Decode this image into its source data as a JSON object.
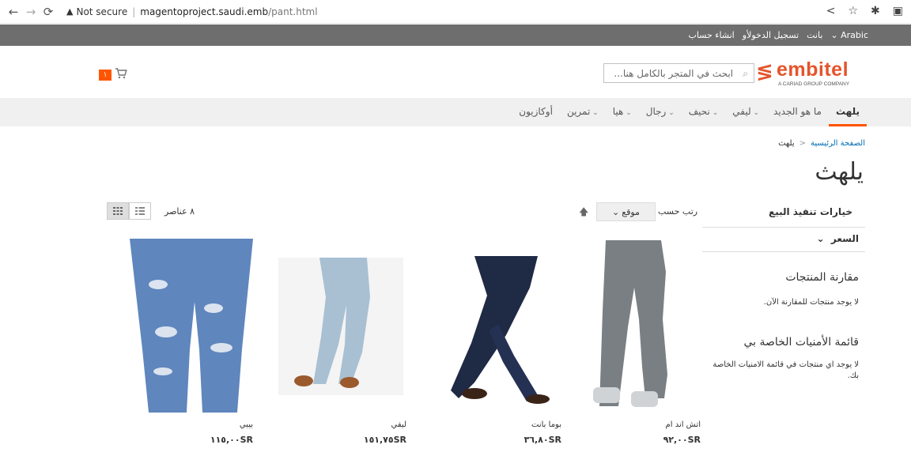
{
  "browser": {
    "security_text": "Not secure",
    "url_host": "magentoproject.saudi.emb",
    "url_path": "/pant.html"
  },
  "topbar": {
    "language": "Arabic",
    "link_pants": "بانت",
    "link_signin": "تسجيل الدخول",
    "link_or": "أو",
    "link_create": "انشاء حساب"
  },
  "header": {
    "logo_word": "embitel",
    "logo_tag": "A CARIAD GROUP COMPANY",
    "search_placeholder": "ابحث في المتجر بالكامل هنا...",
    "cart_count": "١"
  },
  "nav": {
    "items": [
      {
        "label": "يلهث",
        "dropdown": false,
        "active": true
      },
      {
        "label": "ما هو الجديد",
        "dropdown": false,
        "active": false
      },
      {
        "label": "ليفي",
        "dropdown": true,
        "active": false
      },
      {
        "label": "نحيف",
        "dropdown": true,
        "active": false
      },
      {
        "label": "رجال",
        "dropdown": true,
        "active": false
      },
      {
        "label": "هيا",
        "dropdown": true,
        "active": false
      },
      {
        "label": "تمرين",
        "dropdown": true,
        "active": false
      },
      {
        "label": "أوكازيون",
        "dropdown": false,
        "active": false
      }
    ]
  },
  "breadcrumb": {
    "home": "الصفحة الرئيسية",
    "current": "يلهث"
  },
  "page_title": "يلهث",
  "sidebar": {
    "filter_title": "خيارات تنفيذ البيع",
    "price_filter": "السعر",
    "compare_title": "مقارنة المنتجات",
    "compare_empty": "لا يوجد منتجات للمقارنة الآن.",
    "wishlist_title": "قائمة الأمنيات الخاصة بي",
    "wishlist_empty": "لا يوجد اي منتجات في قائمة الامنيات الخاصة بك."
  },
  "toolbar": {
    "sort_label": "رتب حسب",
    "sort_value": "موقع",
    "item_count": "٨ عناصر"
  },
  "products": [
    {
      "name": "اتش اند ام",
      "price": "٩٢,٠٠SR"
    },
    {
      "name": "بوما بانت",
      "price": "٣٦,٨٠SR"
    },
    {
      "name": "ليفي",
      "price": "١٥١,٧٥SR"
    },
    {
      "name": "بيبي",
      "price": "١١٥,٠٠SR"
    }
  ],
  "colors": {
    "accent": "#ff5501",
    "topbar": "#6e6e6e",
    "nav_bg": "#f0f0f0",
    "logo": "#e4542a"
  }
}
